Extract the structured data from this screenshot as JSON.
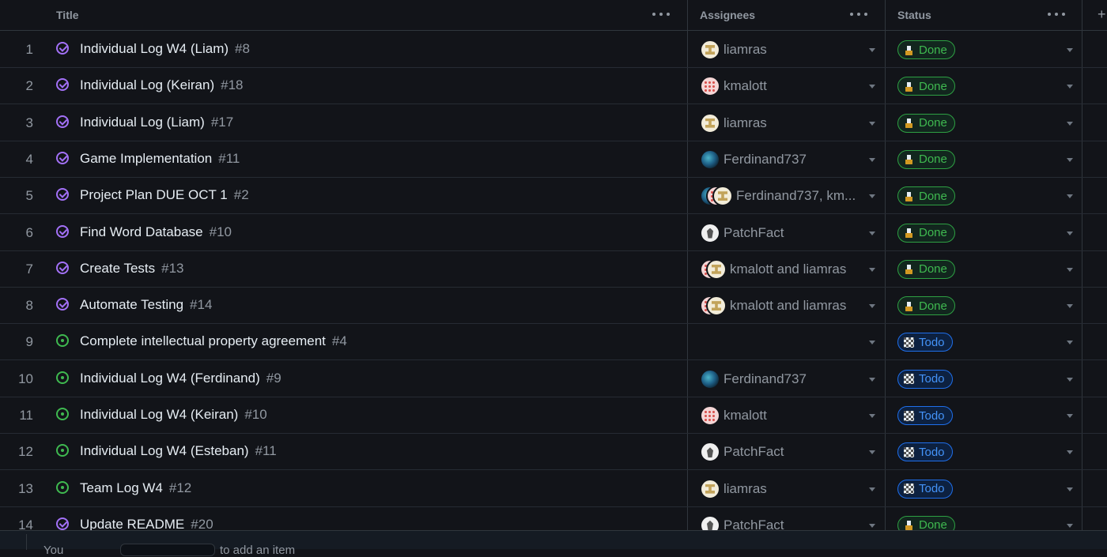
{
  "header": {
    "title_label": "Title",
    "assignees_label": "Assignees",
    "status_label": "Status",
    "add_field_icon": "plus-icon"
  },
  "rows": [
    {
      "num": "1",
      "state": "closed",
      "title": "Individual Log W4 (Liam)",
      "issue": "#8",
      "avatars": [
        "liam"
      ],
      "assignees": "liamras",
      "status": "Done"
    },
    {
      "num": "2",
      "state": "closed",
      "title": "Individual Log (Keiran)",
      "issue": "#18",
      "avatars": [
        "keiran"
      ],
      "assignees": "kmalott",
      "status": "Done"
    },
    {
      "num": "3",
      "state": "closed",
      "title": "Individual Log (Liam)",
      "issue": "#17",
      "avatars": [
        "liam"
      ],
      "assignees": "liamras",
      "status": "Done"
    },
    {
      "num": "4",
      "state": "closed",
      "title": "Game Implementation",
      "issue": "#11",
      "avatars": [
        "ferd"
      ],
      "assignees": "Ferdinand737",
      "status": "Done"
    },
    {
      "num": "5",
      "state": "closed",
      "title": "Project Plan DUE OCT 1",
      "issue": "#2",
      "avatars": [
        "ferd",
        "keiran",
        "liam"
      ],
      "assignees": "Ferdinand737, km...",
      "status": "Done"
    },
    {
      "num": "6",
      "state": "closed",
      "title": "Find Word Database",
      "issue": "#10",
      "avatars": [
        "patch"
      ],
      "assignees": "PatchFact",
      "status": "Done"
    },
    {
      "num": "7",
      "state": "closed",
      "title": "Create Tests",
      "issue": "#13",
      "avatars": [
        "keiran",
        "liam"
      ],
      "assignees": "kmalott and liamras",
      "status": "Done"
    },
    {
      "num": "8",
      "state": "closed",
      "title": "Automate Testing",
      "issue": "#14",
      "avatars": [
        "keiran",
        "liam"
      ],
      "assignees": "kmalott and liamras",
      "status": "Done"
    },
    {
      "num": "9",
      "state": "open",
      "title": "Complete intellectual property agreement",
      "issue": "#4",
      "avatars": [],
      "assignees": "",
      "status": "Todo"
    },
    {
      "num": "10",
      "state": "open",
      "title": "Individual Log W4 (Ferdinand)",
      "issue": "#9",
      "avatars": [
        "ferd"
      ],
      "assignees": "Ferdinand737",
      "status": "Todo"
    },
    {
      "num": "11",
      "state": "open",
      "title": "Individual Log W4 (Keiran)",
      "issue": "#10",
      "avatars": [
        "keiran"
      ],
      "assignees": "kmalott",
      "status": "Todo"
    },
    {
      "num": "12",
      "state": "open",
      "title": "Individual Log W4 (Esteban)",
      "issue": "#11",
      "avatars": [
        "patch"
      ],
      "assignees": "PatchFact",
      "status": "Todo"
    },
    {
      "num": "13",
      "state": "open",
      "title": "Team Log W4",
      "issue": "#12",
      "avatars": [
        "liam"
      ],
      "assignees": "liamras",
      "status": "Todo"
    },
    {
      "num": "14",
      "state": "closed",
      "title": "Update README",
      "issue": "#20",
      "avatars": [
        "patch"
      ],
      "assignees": "PatchFact",
      "status": "Done"
    }
  ],
  "footer": {
    "text_left": "You",
    "text_right": "to add an item"
  },
  "colors": {
    "done": "#3fb950",
    "todo": "#4493f8",
    "closed_icon": "#a371f7",
    "open_icon": "#3fb950"
  }
}
